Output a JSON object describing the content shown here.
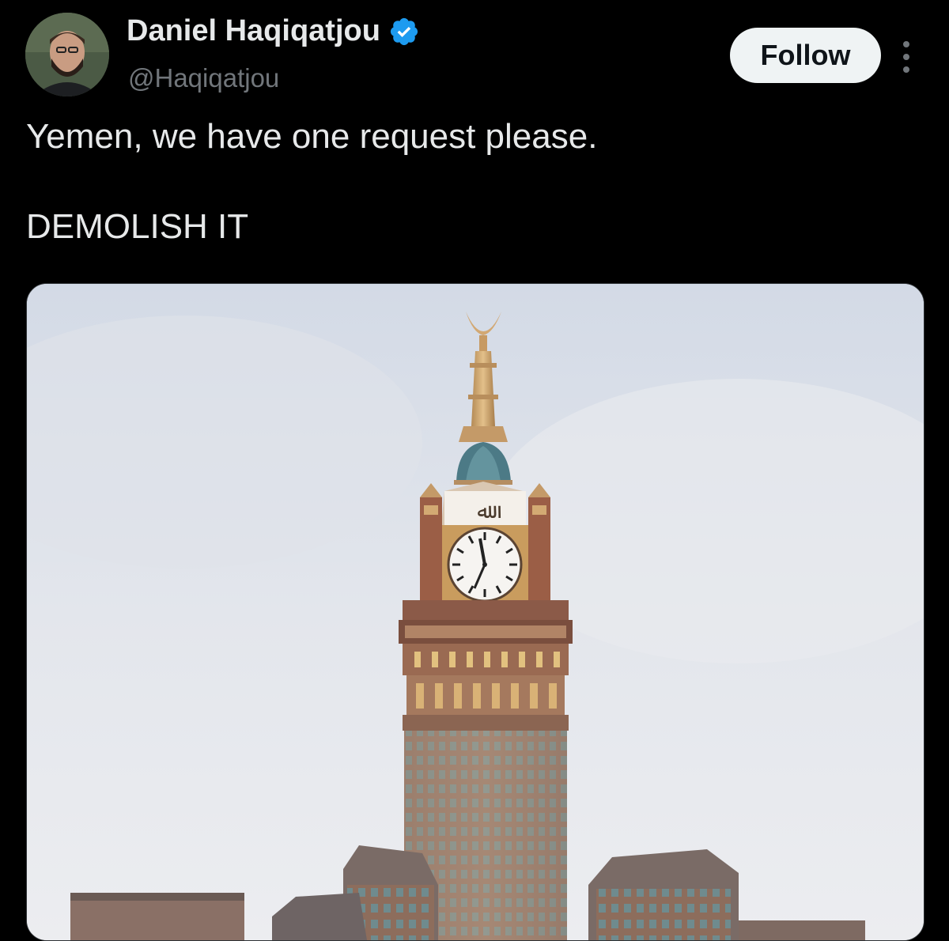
{
  "author": {
    "name": "Daniel Haqiqatjou",
    "handle": "@Haqiqatjou",
    "verified": true,
    "verified_color": "#1d9bf0"
  },
  "actions": {
    "follow_label": "Follow"
  },
  "tweet": {
    "lines": [
      "Yemen, we have one request please.",
      "DEMOLISH IT"
    ]
  },
  "media": {
    "type": "photo",
    "icon": "photo-clock-tower"
  },
  "colors": {
    "background": "#000000",
    "text": "#e7e9ea",
    "secondary_text": "#71767b",
    "follow_bg": "#eff3f4",
    "follow_text": "#0f1419"
  }
}
